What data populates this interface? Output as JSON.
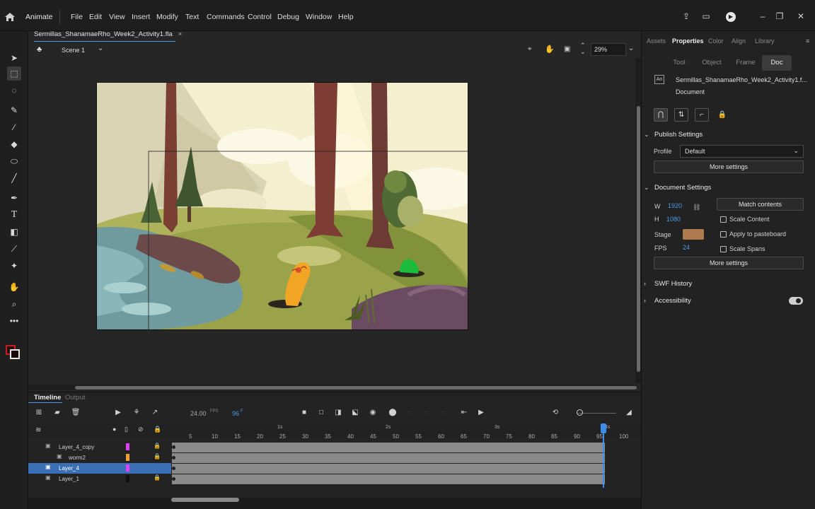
{
  "app": {
    "name": "Animate"
  },
  "menu": [
    "File",
    "Edit",
    "View",
    "Insert",
    "Modify",
    "Text",
    "Commands",
    "Control",
    "Debug",
    "Window",
    "Help"
  ],
  "document": {
    "tab_title": "Sermillas_ShanamaeRho_Week2_Activity1.fla",
    "close": "×"
  },
  "scene": {
    "label": "Scene 1",
    "zoom": "29%"
  },
  "timeline": {
    "tabs": [
      "Timeline",
      "Output"
    ],
    "fps": "24.00",
    "fps_unit": "FPS",
    "frame": "96",
    "frame_unit": "F",
    "time_marks": [
      "1s",
      "2s",
      "3s",
      "4s"
    ],
    "ruler": [
      "5",
      "10",
      "15",
      "20",
      "25",
      "30",
      "35",
      "40",
      "45",
      "50",
      "55",
      "60",
      "65",
      "70",
      "75",
      "80",
      "85",
      "90",
      "95",
      "100"
    ],
    "layers": [
      {
        "name": "Layer_4_copy",
        "color": "#e040fb",
        "locked": true,
        "folder": true
      },
      {
        "name": "worm2",
        "color": "#f0a030",
        "locked": true,
        "folder": false
      },
      {
        "name": "Layer_4",
        "color": "#e040fb",
        "locked": false,
        "folder": false,
        "selected": true
      },
      {
        "name": "Layer_1",
        "color": "#111111",
        "locked": true,
        "folder": false
      }
    ]
  },
  "panel": {
    "tabs": [
      "Assets",
      "Properties",
      "Color",
      "Align",
      "Library"
    ],
    "active_tab": "Properties",
    "subtabs": [
      "Tool",
      "Object",
      "Frame",
      "Doc"
    ],
    "active_subtab": "Doc",
    "doc_name": "Sermillas_ShanamaeRho_Week2_Activity1.f...",
    "doc_type": "Document",
    "publish": {
      "title": "Publish Settings",
      "profile_label": "Profile",
      "profile_value": "Default",
      "more": "More settings"
    },
    "docsettings": {
      "title": "Document Settings",
      "w_label": "W",
      "w": "1920",
      "h_label": "H",
      "h": "1080",
      "match": "Match contents",
      "scale_content": "Scale Content",
      "stage_label": "Stage",
      "stage_color": "#b07a4f",
      "apply_pasteboard": "Apply to pasteboard",
      "fps_label": "FPS",
      "fps": "24",
      "scale_spans": "Scale Spans",
      "more": "More settings"
    },
    "swf_history": "SWF History",
    "accessibility": "Accessibility"
  },
  "colors": {
    "stroke": "#c41e1e",
    "fill": "#2b0b0b",
    "accent": "#4b9be8"
  }
}
